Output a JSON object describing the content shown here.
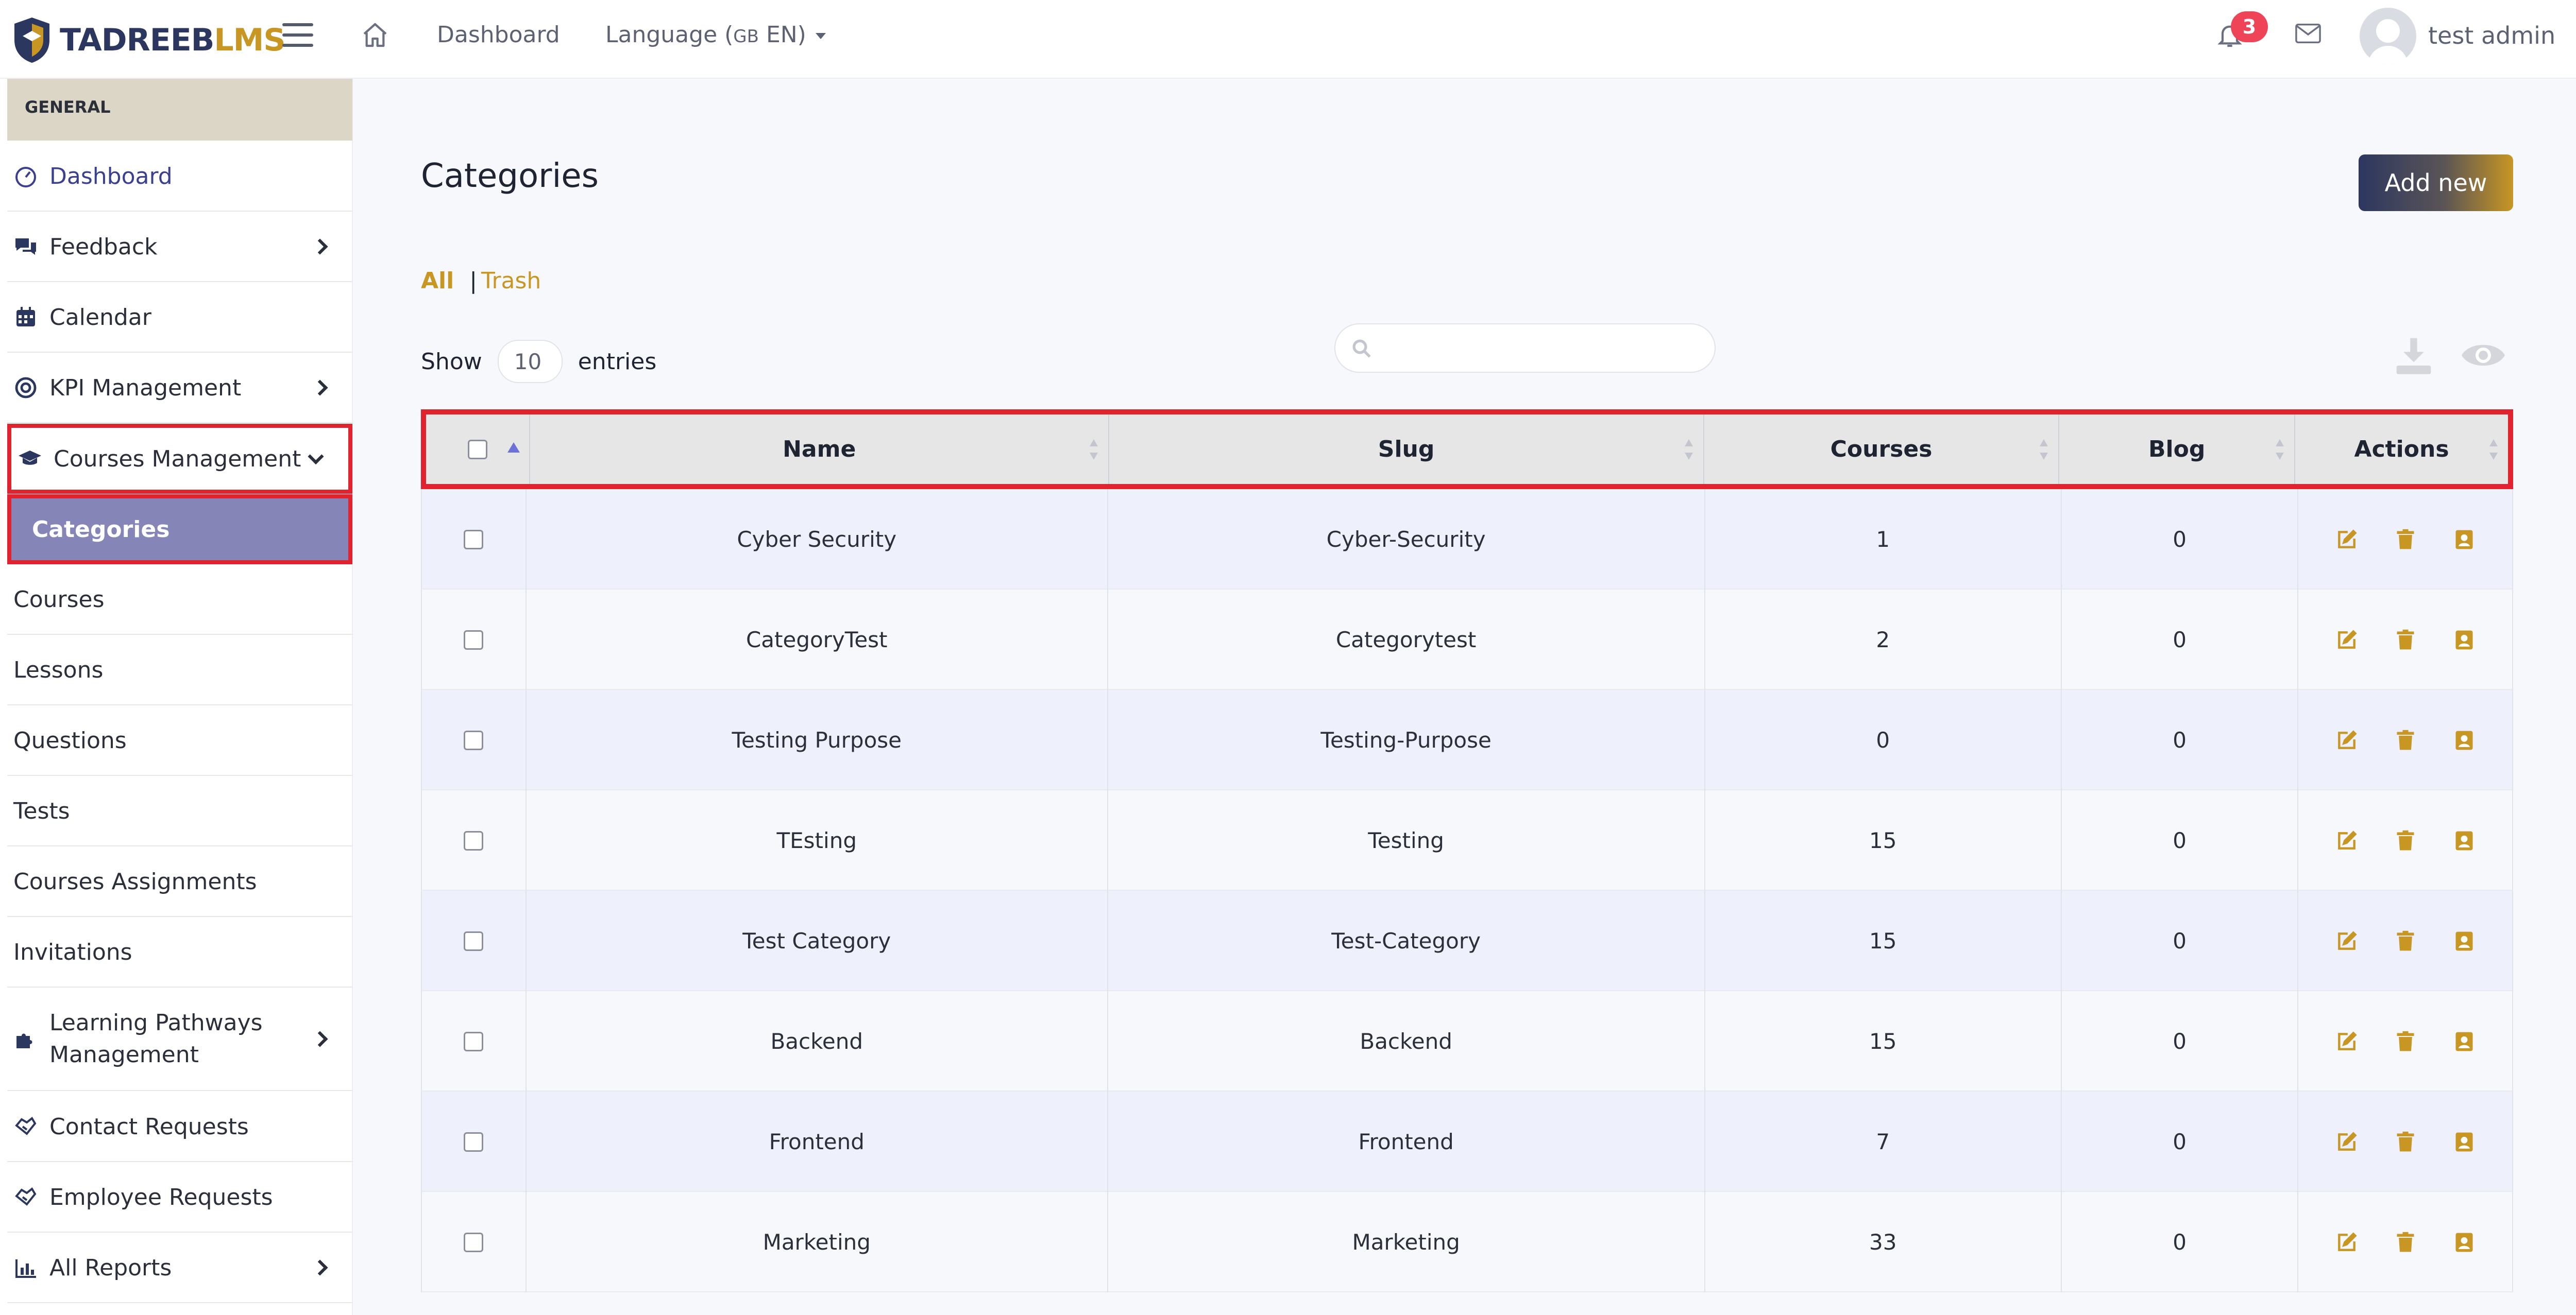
{
  "brand": {
    "name_part1": "TADREEB",
    "name_part2": "LMS",
    "primary": "#2c3760",
    "accent": "#c79623"
  },
  "topbar": {
    "dashboard": "Dashboard",
    "language_label": "Language (",
    "language_code": "GB",
    "language_value": " EN)",
    "notifications_count": "3",
    "user_name": "test admin"
  },
  "sidebar": {
    "section": "GENERAL",
    "items": [
      {
        "label": "Dashboard",
        "icon": "gauge-icon"
      },
      {
        "label": "Feedback",
        "icon": "comments-icon"
      },
      {
        "label": "Calendar",
        "icon": "calendar-icon"
      },
      {
        "label": "KPI Management",
        "icon": "target-icon"
      },
      {
        "label": "Courses Management",
        "icon": "graduation-cap-icon"
      },
      {
        "label": "Categories"
      },
      {
        "label": "Courses"
      },
      {
        "label": "Lessons"
      },
      {
        "label": "Questions"
      },
      {
        "label": "Tests"
      },
      {
        "label": "Courses Assignments"
      },
      {
        "label": "Invitations"
      },
      {
        "label": "Learning Pathways Management",
        "icon": "puzzle-icon"
      },
      {
        "label": "Contact Requests",
        "icon": "handshake-icon"
      },
      {
        "label": "Employee Requests",
        "icon": "handshake-icon"
      },
      {
        "label": "All Reports",
        "icon": "bar-chart-icon"
      }
    ]
  },
  "main": {
    "title": "Categories",
    "add_new": "Add new",
    "filter_all": "All",
    "filter_sep": "|",
    "filter_trash": "Trash",
    "show_label": "Show",
    "entries_value": "10",
    "entries_label": "entries",
    "search_placeholder": ""
  },
  "table": {
    "columns": [
      "Name",
      "Slug",
      "Courses",
      "Blog",
      "Actions"
    ],
    "rows": [
      {
        "name": "Cyber Security",
        "slug": "Cyber-Security",
        "courses": "1",
        "blog": "0"
      },
      {
        "name": "CategoryTest",
        "slug": "Categorytest",
        "courses": "2",
        "blog": "0"
      },
      {
        "name": "Testing Purpose",
        "slug": "Testing-Purpose",
        "courses": "0",
        "blog": "0"
      },
      {
        "name": "TEsting",
        "slug": "Testing",
        "courses": "15",
        "blog": "0"
      },
      {
        "name": "Test Category",
        "slug": "Test-Category",
        "courses": "15",
        "blog": "0"
      },
      {
        "name": "Backend",
        "slug": "Backend",
        "courses": "15",
        "blog": "0"
      },
      {
        "name": "Frontend",
        "slug": "Frontend",
        "courses": "7",
        "blog": "0"
      },
      {
        "name": "Marketing",
        "slug": "Marketing",
        "courses": "33",
        "blog": "0"
      }
    ]
  }
}
